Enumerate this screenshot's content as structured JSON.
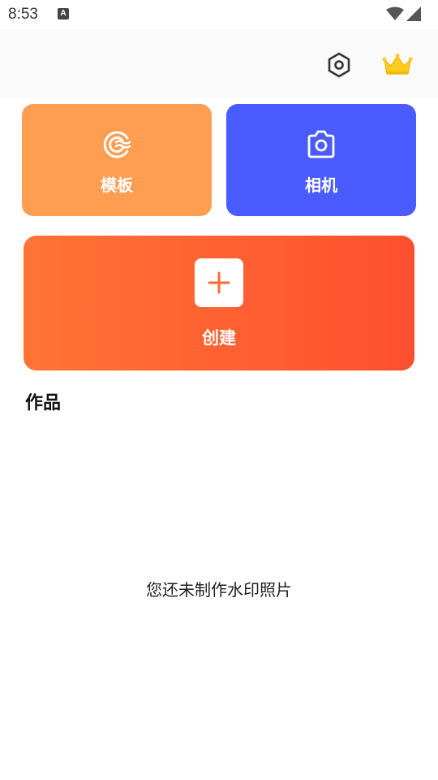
{
  "status_bar": {
    "time": "8:53",
    "notification_letter": "A"
  },
  "header": {
    "settings_icon": "settings-hexagon-icon",
    "vip_icon": "crown-icon"
  },
  "cards": {
    "template_label": "模板",
    "camera_label": "相机",
    "create_label": "创建"
  },
  "works": {
    "title": "作品",
    "empty_message": "您还未制作水印照片"
  },
  "colors": {
    "template_card": "#ff9d50",
    "camera_card": "#4a5cff",
    "create_gradient_start": "#ff7434",
    "create_gradient_end": "#ff4f30",
    "crown": "#ffcc1f"
  }
}
